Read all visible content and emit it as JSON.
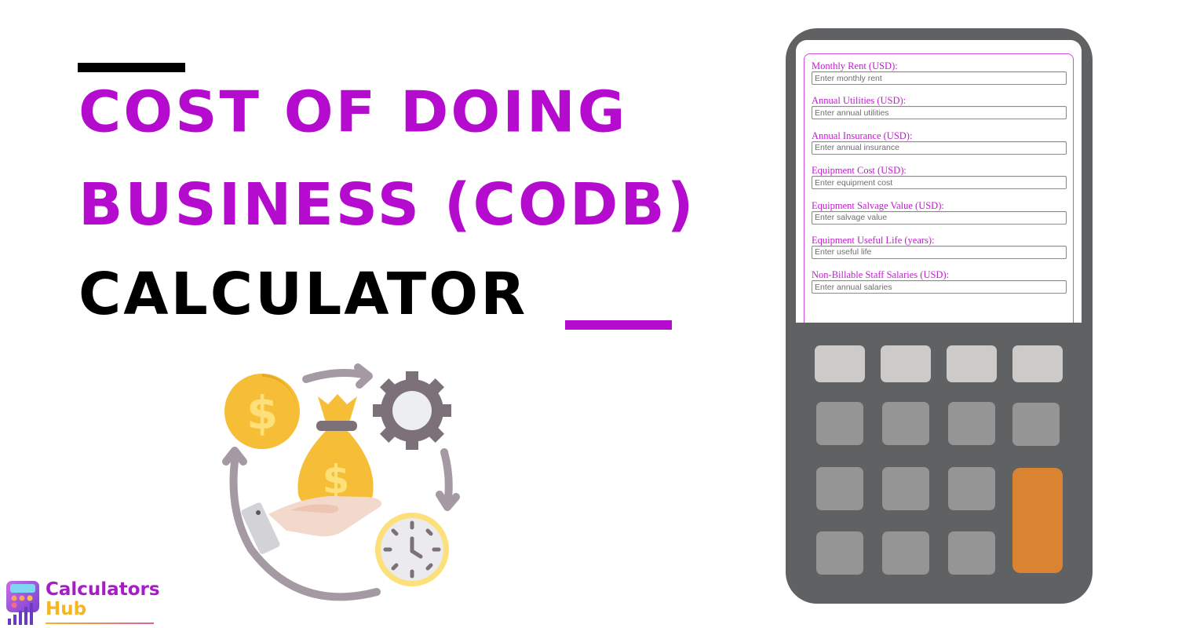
{
  "title": {
    "line1": "Cost of Doing",
    "line2": "Business (CODB)",
    "line3": "Calculator"
  },
  "colors": {
    "accent": "#b40bcf",
    "calculator_body": "#606163",
    "key_light": "#cccbca",
    "key_mid": "#959595",
    "key_orange": "#da8431"
  },
  "form": {
    "fields": [
      {
        "label": "Monthly Rent (USD):",
        "placeholder": "Enter monthly rent"
      },
      {
        "label": "Annual Utilities (USD):",
        "placeholder": "Enter annual utilities"
      },
      {
        "label": "Annual Insurance (USD):",
        "placeholder": "Enter annual insurance"
      },
      {
        "label": "Equipment Cost (USD):",
        "placeholder": "Enter equipment cost"
      },
      {
        "label": "Equipment Salvage Value (USD):",
        "placeholder": "Enter salvage value"
      },
      {
        "label": "Equipment Useful Life (years):",
        "placeholder": "Enter useful life"
      },
      {
        "label": "Non-Billable Staff Salaries (USD):",
        "placeholder": "Enter annual salaries"
      }
    ]
  },
  "illustration": {
    "icons": [
      "dollar-coin-icon",
      "money-bag-icon",
      "hand-icon",
      "gear-icon",
      "clock-icon",
      "cycle-arrows-icon"
    ]
  },
  "logo": {
    "line1": "Calculators",
    "line2": "Hub"
  }
}
